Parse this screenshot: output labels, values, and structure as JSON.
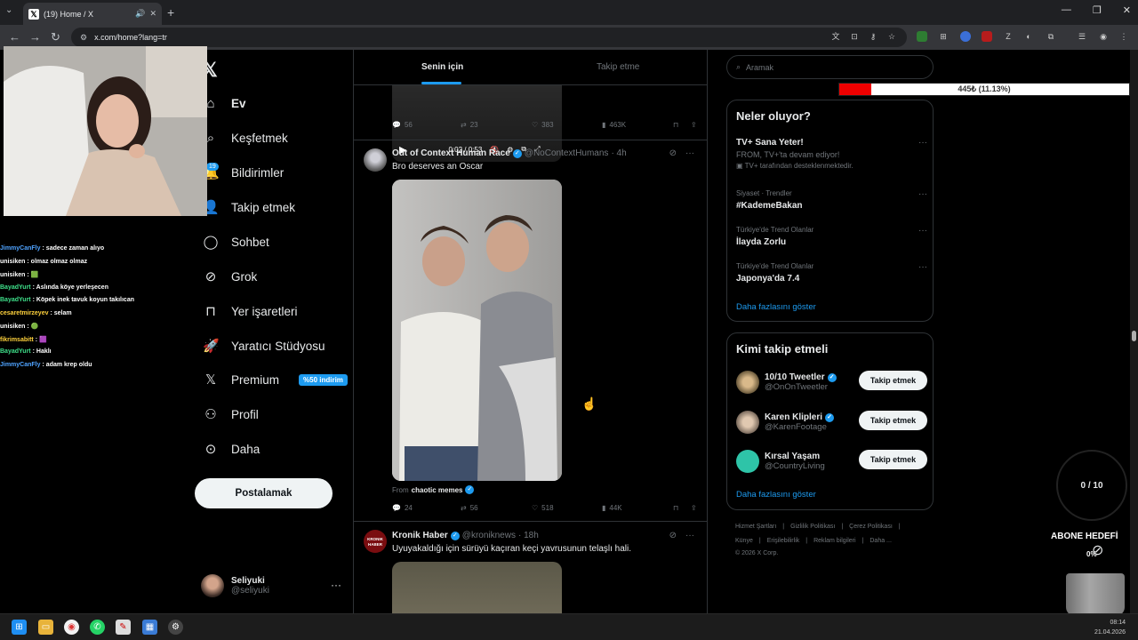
{
  "browser": {
    "tab_title": "(19) Home / X",
    "url": "x.com/home?lang=tr",
    "new_tab": "+",
    "tab_close": "✕"
  },
  "sidebar": {
    "items": [
      {
        "label": "Ev",
        "icon": "home-icon"
      },
      {
        "label": "Keşfetmek",
        "icon": "search-icon"
      },
      {
        "label": "Bildirimler",
        "icon": "bell-icon"
      },
      {
        "label": "Takip etmek",
        "icon": "add-person-icon"
      },
      {
        "label": "Sohbet",
        "icon": "chat-icon"
      },
      {
        "label": "Grok",
        "icon": "grok-icon"
      },
      {
        "label": "Yer işaretleri",
        "icon": "bookmark-icon"
      },
      {
        "label": "Yaratıcı Stüdyosu",
        "icon": "rocket-icon"
      },
      {
        "label": "Premium",
        "icon": "x-icon"
      },
      {
        "label": "Profil",
        "icon": "person-icon"
      },
      {
        "label": "Daha",
        "icon": "more-circle-icon"
      }
    ],
    "notif_count": "19",
    "premium_badge": "%50 indirim",
    "post_button": "Postalamak",
    "profile_name": "Seliyuki",
    "profile_handle": "@seliyuki",
    "profile_more": "···"
  },
  "feed": {
    "tabs": [
      "Senin için",
      "Takip etme"
    ],
    "video_time": "0:02 / 0:53",
    "tweet0_actions": {
      "reply": "56",
      "retweet": "23",
      "like": "383",
      "views": "463K"
    },
    "tweet1": {
      "name": "Out of Context Human Race",
      "handle": "@NoContextHumans",
      "time": "· 4h",
      "text": "Bro deserves an Oscar",
      "from_prefix": "From",
      "from_account": "chaotic memes",
      "actions": {
        "reply": "24",
        "retweet": "56",
        "like": "518",
        "views": "44K"
      }
    },
    "tweet2": {
      "name": "Kronik Haber",
      "handle": "@kroniknews",
      "time": "· 18h",
      "text": "Uyuyakaldığı için sürüyü kaçıran keçi yavrusunun telaşlı hali.",
      "avatar_text": "KRONIK HABER"
    }
  },
  "right": {
    "search_placeholder": "Aramak",
    "trends_title": "Neler oluyor?",
    "trends": [
      {
        "context": "",
        "title": "TV+ Sana Yeter!",
        "sub": "FROM, TV+'ta devam ediyor!",
        "promo": "TV+ tarafından desteklenmektedir."
      },
      {
        "context": "Siyaset · Trendler",
        "title": "#KademeBakan"
      },
      {
        "context": "Türkiye'de Trend Olanlar",
        "title": "İlayda Zorlu"
      },
      {
        "context": "Türkiye'de Trend Olanlar",
        "title": "Japonya'da 7.4"
      }
    ],
    "show_more": "Daha fazlasını göster",
    "follow_title": "Kimi takip etmeli",
    "follow": [
      {
        "name": "10/10 Tweetler",
        "handle": "@OnOnTweetler"
      },
      {
        "name": "Karen Klipleri",
        "handle": "@KarenFootage"
      },
      {
        "name": "Kırsal Yaşam",
        "handle": "@CountryLiving"
      }
    ],
    "follow_button": "Takip etmek",
    "follow_show_more": "Daha fazlasını göster",
    "footer_line1": [
      "Hizmet Şartları",
      "|",
      "Gizlilik Politikası",
      "|",
      "Çerez Politikası",
      "|"
    ],
    "footer_line2": [
      "Künye",
      "|",
      "Erişilebilirlik",
      "|",
      "Reklam bilgileri",
      "|",
      "Daha ..."
    ],
    "copyright": "© 2026 X Corp."
  },
  "overlay": {
    "chat": [
      {
        "user": "JimmyCanFly",
        "msg": ": sadece zaman alıyo",
        "color": "#4fa3ff"
      },
      {
        "user": "unisiken",
        "msg": ": olmaz olmaz olmaz",
        "color": "#ffffff"
      },
      {
        "user": "unisiken",
        "msg": ": 🟩",
        "color": "#ffffff"
      },
      {
        "user": "BayadYurt",
        "msg": ": Aslında köye yerleşecen",
        "color": "#3ee08a"
      },
      {
        "user": "BayadYurt",
        "msg": ": Köpek inek tavuk koyun takılıcan",
        "color": "#3ee08a"
      },
      {
        "user": "cesaretmirzeyev",
        "msg": ": selam",
        "color": "#ffd23c"
      },
      {
        "user": "unisiken",
        "msg": ": 🟢",
        "color": "#ffffff"
      },
      {
        "user": "fikrimsabitt",
        "msg": ": 🟪",
        "color": "#ffd23c"
      },
      {
        "user": "BayadYurt",
        "msg": ": Haklı",
        "color": "#3ee08a"
      },
      {
        "user": "JimmyCanFly",
        "msg": ": adam krep oldu",
        "color": "#4fa3ff"
      }
    ],
    "donation_text": "445₺ (11.13%)",
    "donation_fraction": 0.1113,
    "goal_counter": "0 / 10",
    "sub_goal": "ABONE HEDEFİ",
    "sub_pct": "0%"
  },
  "taskbar": {
    "time": "08:14",
    "date": "21.04.2026"
  }
}
